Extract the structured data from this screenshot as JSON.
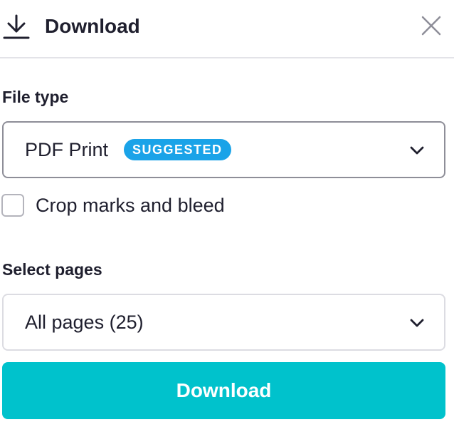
{
  "header": {
    "title": "Download",
    "icon": "download-icon",
    "close_icon": "close-icon"
  },
  "file_type": {
    "label": "File type",
    "selected_value": "PDF Print",
    "badge": "SUGGESTED",
    "badge_color": "#1aa3e8"
  },
  "crop_marks": {
    "label": "Crop marks and bleed",
    "checked": false
  },
  "pages": {
    "label": "Select pages",
    "selected_value": "All pages (25)"
  },
  "download_button": {
    "label": "Download",
    "color": "#00c2cc"
  }
}
